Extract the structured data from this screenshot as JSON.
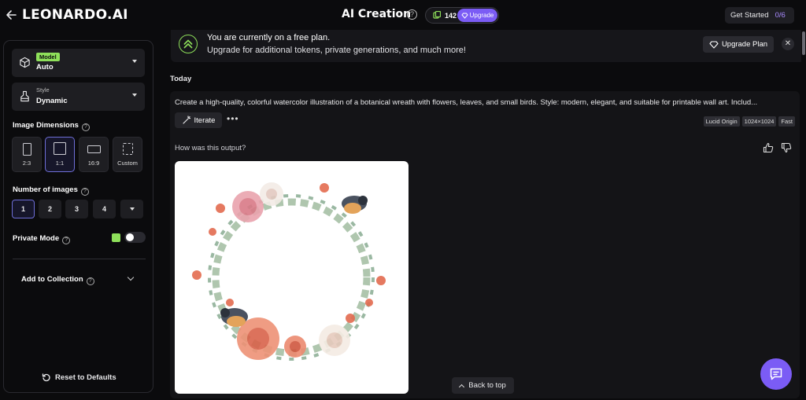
{
  "header": {
    "logo": "LEONARDO.AI",
    "title": "AI Creation",
    "tokens": "142",
    "upgrade": "Upgrade",
    "get_started": "Get Started",
    "get_started_progress": "0/6"
  },
  "sidebar": {
    "model_badge": "Model",
    "model_value": "Auto",
    "style_label": "Style",
    "style_value": "Dynamic",
    "image_dimensions_label": "Image Dimensions",
    "dimensions": [
      {
        "label": "2:3",
        "selected": false
      },
      {
        "label": "1:1",
        "selected": true
      },
      {
        "label": "16:9",
        "selected": false
      },
      {
        "label": "Custom",
        "selected": false
      }
    ],
    "number_of_images_label": "Number of images",
    "numbers": [
      "1",
      "2",
      "3",
      "4"
    ],
    "selected_number": "1",
    "private_mode_label": "Private Mode",
    "private_mode_on": false,
    "add_to_collection_label": "Add to Collection",
    "reset_label": "Reset to Defaults"
  },
  "banner": {
    "line1": "You are currently on a free plan.",
    "line2": "Upgrade for additional tokens, private generations, and much more!",
    "upgrade_plan": "Upgrade Plan",
    "close": "✕"
  },
  "feed": {
    "today_label": "Today",
    "prompt": "Create a high-quality, colorful watercolor illustration of a botanical wreath with flowers, leaves, and small birds. Style: modern, elegant, and suitable for printable wall art. Includ...",
    "iterate_label": "Iterate",
    "more_label": "•••",
    "tags": [
      "Lucid Origin",
      "1024×1024",
      "Fast"
    ],
    "feedback_question": "How was this output?",
    "back_to_top": "Back to top"
  },
  "colors": {
    "accent": "#7b5cf5",
    "green": "#8ee05a",
    "background": "#0b0b0d"
  }
}
